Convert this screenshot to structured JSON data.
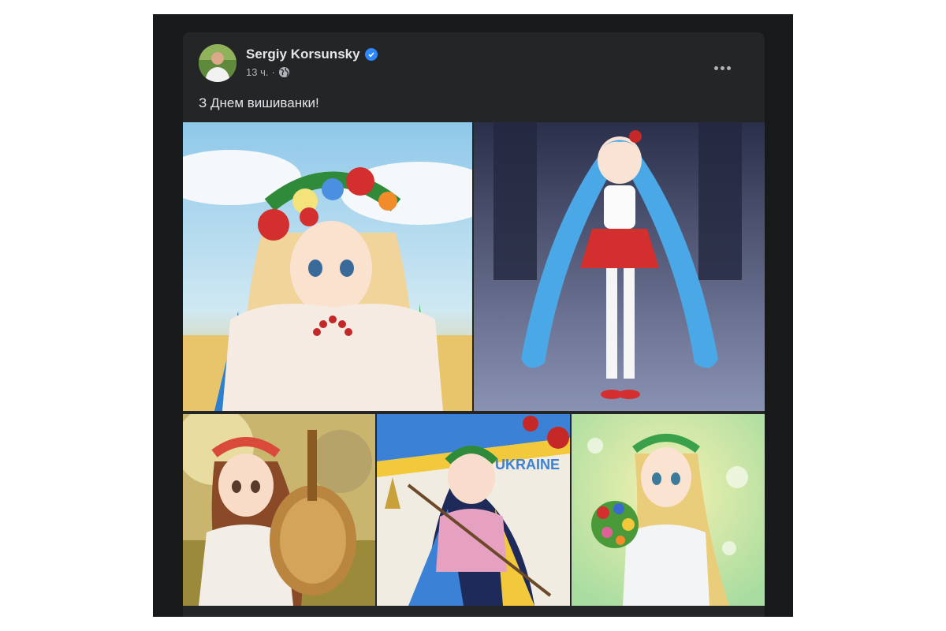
{
  "post": {
    "author": {
      "name": "Sergiy Korsunsky",
      "verified": true
    },
    "time": "13 ч.",
    "separator": "·",
    "privacy_icon": "globe-icon",
    "more_icon": "more-options-icon",
    "text": "З Днем вишиванки!",
    "images": [
      {
        "name": "anime-girl-flower-wreath-image"
      },
      {
        "name": "anime-girl-blue-twintails-image"
      },
      {
        "name": "anime-girl-bandura-image"
      },
      {
        "name": "anime-girl-ukraine-ribbons-image",
        "caption": "UKRAINE"
      },
      {
        "name": "anime-girl-bouquet-image"
      }
    ]
  },
  "colors": {
    "screen_bg": "#18191a",
    "card_bg": "#242526",
    "text_primary": "#e4e6eb",
    "text_secondary": "#b0b3b8",
    "verified_blue": "#2d88ff"
  }
}
